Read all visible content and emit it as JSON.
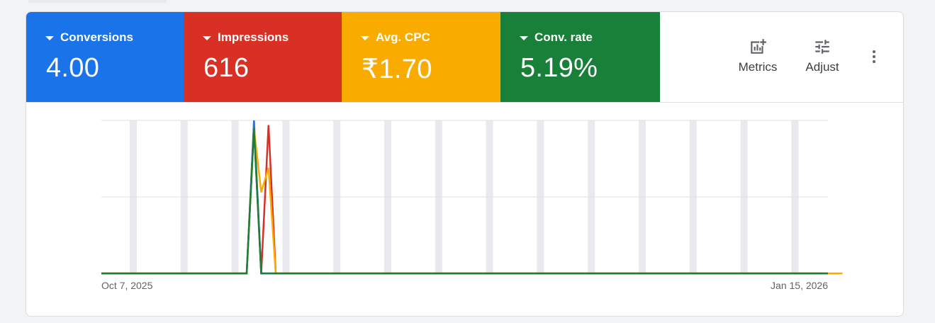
{
  "metrics": [
    {
      "label": "Conversions",
      "value": "4.00",
      "color": "#1a73e8"
    },
    {
      "label": "Impressions",
      "value": "616",
      "color": "#d93025"
    },
    {
      "label": "Avg. CPC",
      "value": "₹1.70",
      "color": "#f9ab00"
    },
    {
      "label": "Conv. rate",
      "value": "5.19%",
      "color": "#188038"
    }
  ],
  "toolbar": {
    "metrics_label": "Metrics",
    "metrics_icon": "add-chart-icon",
    "adjust_label": "Adjust",
    "adjust_icon": "tune-icon",
    "more_icon": "more-vert-icon"
  },
  "chart_data": {
    "type": "line",
    "x_start": "Oct 7, 2025",
    "x_end": "Jan 15, 2026",
    "tick_labels": [
      "Oct 7, 2025",
      "Jan 15, 2026"
    ],
    "x_index": [
      0,
      1,
      2,
      3,
      4,
      5,
      6,
      7,
      8,
      9,
      10,
      11,
      12,
      13,
      14,
      15,
      16,
      17,
      18,
      19,
      20,
      21,
      22,
      23,
      24,
      25,
      26,
      27,
      28,
      29,
      30,
      31,
      32,
      33,
      34,
      35,
      36,
      37,
      38,
      39,
      40,
      41,
      42,
      43,
      44,
      45,
      46,
      47,
      48,
      49,
      50,
      51,
      52,
      53,
      54,
      55,
      56,
      57,
      58,
      59,
      60,
      61,
      62,
      63,
      64,
      65,
      66,
      67,
      68,
      69,
      70,
      71,
      72,
      73,
      74,
      75,
      76,
      77,
      78,
      79,
      80,
      81,
      82,
      83,
      84,
      85,
      86,
      87,
      88,
      89,
      90,
      91,
      92,
      93,
      94,
      95,
      96,
      97,
      98,
      99,
      100
    ],
    "series": [
      {
        "name": "Conversions",
        "color": "#1a73e8",
        "values": [
          0,
          0,
          0,
          0,
          0,
          0,
          0,
          0,
          0,
          0,
          0,
          0,
          0,
          0,
          0,
          0,
          0,
          0,
          0,
          0,
          0,
          1.0,
          0,
          0,
          0,
          0,
          0,
          0,
          0,
          0,
          0,
          0,
          0,
          0,
          0,
          0,
          0,
          0,
          0,
          0,
          0,
          0,
          0,
          0,
          0,
          0,
          0,
          0,
          0,
          0,
          0,
          0,
          0,
          0,
          0,
          0,
          0,
          0,
          0,
          0,
          0,
          0,
          0,
          0,
          0,
          0,
          0,
          0,
          0,
          0,
          0,
          0,
          0,
          0,
          0,
          0,
          0,
          0,
          0,
          0,
          0,
          0,
          0,
          0,
          0,
          0,
          0,
          0,
          0,
          0,
          0,
          0,
          0,
          0,
          0,
          0,
          0,
          0,
          0,
          0,
          0
        ]
      },
      {
        "name": "Impressions",
        "color": "#d93025",
        "values": [
          0,
          0,
          0,
          0,
          0,
          0,
          0,
          0,
          0,
          0,
          0,
          0,
          0,
          0,
          0,
          0,
          0,
          0,
          0,
          0,
          0,
          0.95,
          0,
          0.97,
          0,
          0,
          0,
          0,
          0,
          0,
          0,
          0,
          0,
          0,
          0,
          0,
          0,
          0,
          0,
          0,
          0,
          0,
          0,
          0,
          0,
          0,
          0,
          0,
          0,
          0,
          0,
          0,
          0,
          0,
          0,
          0,
          0,
          0,
          0,
          0,
          0,
          0,
          0,
          0,
          0,
          0,
          0,
          0,
          0,
          0,
          0,
          0,
          0,
          0,
          0,
          0,
          0,
          0,
          0,
          0,
          0,
          0,
          0,
          0,
          0,
          0,
          0,
          0,
          0,
          0,
          0,
          0,
          0,
          0,
          0,
          0,
          0,
          0,
          0,
          0
        ]
      },
      {
        "name": "Avg. CPC",
        "color": "#f9ab00",
        "values": [
          0,
          0,
          0,
          0,
          0,
          0,
          0,
          0,
          0,
          0,
          0,
          0,
          0,
          0,
          0,
          0,
          0,
          0,
          0,
          0,
          0,
          0.95,
          0.53,
          0.69,
          0,
          0,
          0,
          0,
          0,
          0,
          0,
          0,
          0,
          0,
          0,
          0,
          0,
          0,
          0,
          0,
          0,
          0,
          0,
          0,
          0,
          0,
          0,
          0,
          0,
          0,
          0,
          0,
          0,
          0,
          0,
          0,
          0,
          0,
          0,
          0,
          0,
          0,
          0,
          0,
          0,
          0,
          0,
          0,
          0,
          0,
          0,
          0,
          0,
          0,
          0,
          0,
          0,
          0,
          0,
          0,
          0,
          0,
          0,
          0,
          0,
          0,
          0,
          0,
          0,
          0,
          0,
          0,
          0,
          0,
          0,
          0,
          0,
          0,
          0,
          0,
          0,
          0,
          0
        ]
      },
      {
        "name": "Conv. rate",
        "color": "#188038",
        "values": [
          0,
          0,
          0,
          0,
          0,
          0,
          0,
          0,
          0,
          0,
          0,
          0,
          0,
          0,
          0,
          0,
          0,
          0,
          0,
          0,
          0,
          0.95,
          0,
          0,
          0,
          0,
          0,
          0,
          0,
          0,
          0,
          0,
          0,
          0,
          0,
          0,
          0,
          0,
          0,
          0,
          0,
          0,
          0,
          0,
          0,
          0,
          0,
          0,
          0,
          0,
          0,
          0,
          0,
          0,
          0,
          0,
          0,
          0,
          0,
          0,
          0,
          0,
          0,
          0,
          0,
          0,
          0,
          0,
          0,
          0,
          0,
          0,
          0,
          0,
          0,
          0,
          0,
          0,
          0,
          0,
          0,
          0,
          0,
          0,
          0,
          0,
          0,
          0,
          0,
          0,
          0,
          0,
          0,
          0,
          0,
          0,
          0,
          0,
          0,
          0,
          0
        ]
      }
    ],
    "ylim": [
      0,
      1
    ],
    "grid": true,
    "weekend_bands": true
  }
}
